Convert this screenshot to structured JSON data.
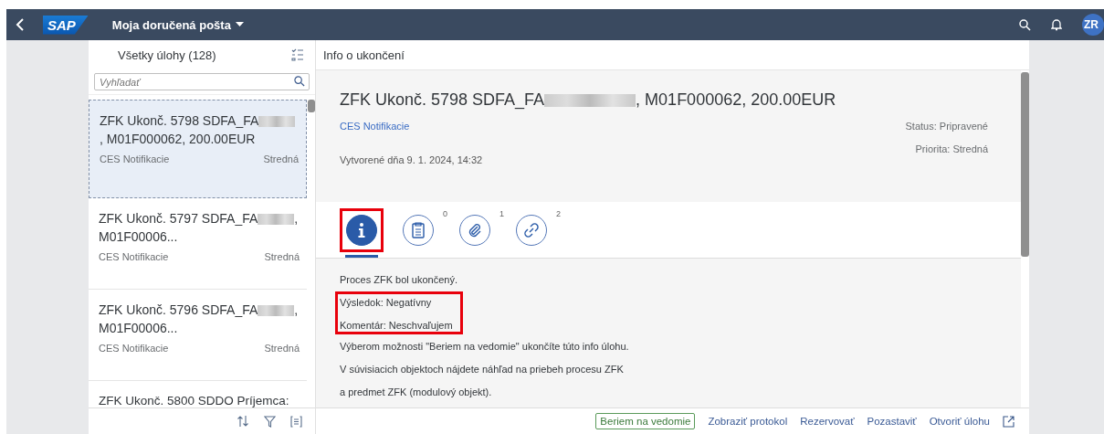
{
  "shell": {
    "logo": "SAP",
    "title": "Moja doručená pošta",
    "avatar": "ZR"
  },
  "list": {
    "header": "Všetky úlohy (128)",
    "search": {
      "placeholder": "Vyhľadať"
    },
    "items": [
      {
        "title_start": "ZFK Ukonč. 5798 SDFA_FA",
        "redacted": true,
        "title_end": ", M01F000062, 200.00EUR",
        "source": "CES Notifikacie",
        "priority": "Stredná",
        "selected": true
      },
      {
        "title_start": "ZFK Ukonč. 5797 SDFA_FA",
        "redacted": true,
        "title_end": ", M01F00006...",
        "source": "CES Notifikacie",
        "priority": "Stredná",
        "selected": false
      },
      {
        "title_start": "ZFK Ukonč. 5796 SDFA_FA",
        "redacted": true,
        "title_end": ", M01F00006...",
        "source": "CES Notifikacie",
        "priority": "Stredná",
        "selected": false
      },
      {
        "title_start": "ZFK Ukonč. 5800 SDDO Príjemca:",
        "selected": false
      }
    ]
  },
  "detail": {
    "header": "Info o ukončení",
    "title_start": "ZFK Ukonč. 5798 SDFA_FA",
    "redacted": true,
    "title_end": ", M01F000062, 200.00EUR",
    "link": "CES Notifikacie",
    "status": "Status: Pripravené",
    "priority": "Priorita: Stredná",
    "created": "Vytvorené dňa 9. 1. 2024, 14:32",
    "tabs": [
      {
        "kind": "info",
        "selected": true,
        "highlighted": true
      },
      {
        "kind": "notes",
        "count": "0",
        "selected": false,
        "highlighted": false
      },
      {
        "kind": "attachments",
        "count": "1",
        "selected": false,
        "highlighted": false
      },
      {
        "kind": "links",
        "count": "2",
        "selected": false,
        "highlighted": false
      }
    ],
    "lines": [
      {
        "text": "Proces ZFK bol ukončený.",
        "highlighted": false
      },
      {
        "text": "Výsledok: Negatívny",
        "highlighted": true
      },
      {
        "text": "Komentár: Neschvaľujem",
        "highlighted": true
      },
      {
        "text": "Výberom možnosti \"Beriem na vedomie\" ukončíte túto info úlohu.",
        "highlighted": false
      },
      {
        "text": "V súvisiacich objektoch nájdete náhľad na priebeh procesu ZFK",
        "highlighted": false
      },
      {
        "text": "a predmet ZFK (modulový objekt).",
        "highlighted": false
      }
    ]
  },
  "footer": {
    "actions": [
      {
        "label": "Beriem na vedomie",
        "kind": "primary"
      },
      {
        "label": "Zobraziť protokol",
        "kind": "link"
      },
      {
        "label": "Rezervovať",
        "kind": "link"
      },
      {
        "label": "Pozastaviť",
        "kind": "link"
      },
      {
        "label": "Otvoriť úlohu",
        "kind": "link"
      }
    ]
  }
}
